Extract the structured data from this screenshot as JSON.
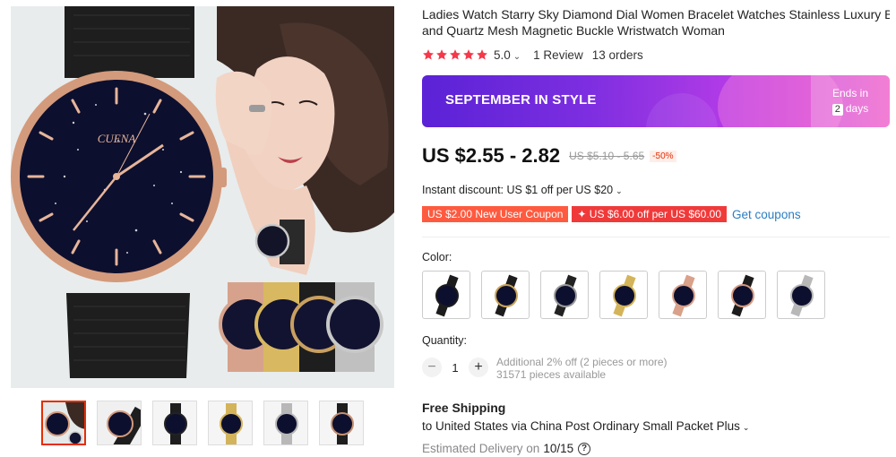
{
  "product": {
    "title_line1": "Ladies Watch Starry Sky Diamond Dial Women Bracelet Watches Stainless Luxury Br",
    "title_line2": "and Quartz Mesh Magnetic Buckle Wristwatch Woman",
    "brand_on_dial": "CUENA"
  },
  "rating": {
    "value": "5.0",
    "stars": 5,
    "reviews": "1 Review",
    "orders": "13 orders"
  },
  "banner": {
    "title": "SEPTEMBER IN STYLE",
    "ends_in": "Ends in",
    "days_count": "2",
    "days_label": "days"
  },
  "price": {
    "current": "US $2.55 - 2.82",
    "original": "US $5.10 - 5.65",
    "discount": "-50%"
  },
  "instant_discount": "Instant discount: US $1 off per US $20",
  "coupons": {
    "new_user": "US $2.00 New User Coupon",
    "store": "✦ US $6.00 off per US $60.00",
    "get_link": "Get coupons"
  },
  "color": {
    "label": "Color:",
    "options": [
      {
        "name": "black-mesh",
        "strap": "#1c1c1c",
        "case": "#1c1c1c"
      },
      {
        "name": "black-gold",
        "strap": "#1c1c1c",
        "case": "#c9a45a"
      },
      {
        "name": "black-silver",
        "strap": "#222222",
        "case": "#9a9a9a"
      },
      {
        "name": "gold",
        "strap": "#d4b45a",
        "case": "#d4b45a"
      },
      {
        "name": "rose-gold",
        "strap": "#d9a08a",
        "case": "#d9a08a"
      },
      {
        "name": "black-rose",
        "strap": "#1c1c1c",
        "case": "#d49a80"
      },
      {
        "name": "silver",
        "strap": "#b8b8b8",
        "case": "#b8b8b8"
      }
    ]
  },
  "quantity": {
    "label": "Quantity:",
    "value": "1",
    "note1": "Additional 2% off (2 pieces or more)",
    "note2": "31571 pieces available"
  },
  "shipping": {
    "title": "Free Shipping",
    "to": "to United States via China Post Ordinary Small Packet Plus",
    "eta_label": "Estimated Delivery on",
    "eta_date": "10/15"
  },
  "icons": {
    "star": "star-icon",
    "chevron": "chevron-down-icon",
    "help": "question-icon"
  },
  "colors": {
    "star": "#f5384a",
    "accent_red": "#e62e04",
    "link": "#2a7dc2"
  }
}
